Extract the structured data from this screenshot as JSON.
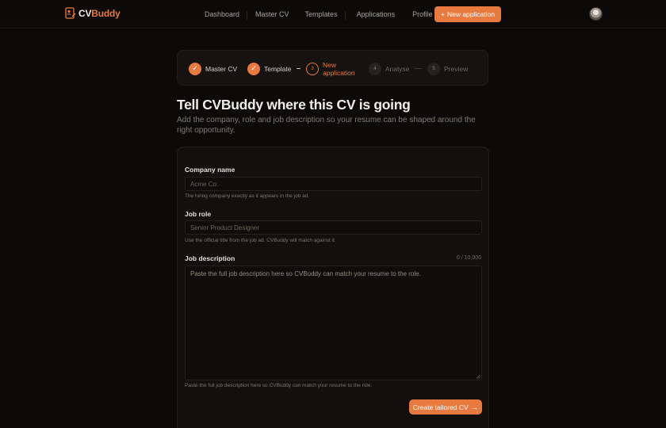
{
  "brand": {
    "name_part1": "CV",
    "name_part2": "Buddy",
    "accent_color": "#e97a3f"
  },
  "nav": {
    "links": [
      "Dashboard",
      "Master CV",
      "Templates",
      "Applications",
      "Profile"
    ],
    "cta_icon": "+",
    "cta_label": "New application"
  },
  "stepper": {
    "steps": [
      {
        "marker": "✓",
        "label": "Master CV",
        "state": "done"
      },
      {
        "marker": "✓",
        "label": "Template",
        "state": "done"
      },
      {
        "marker": "3",
        "label": "New application",
        "state": "current"
      },
      {
        "marker": "4",
        "label": "Analyse",
        "state": "pending"
      },
      {
        "marker": "5",
        "label": "Preview",
        "state": "pending"
      }
    ]
  },
  "page": {
    "title": "Tell CVBuddy where this CV is going",
    "subtitle": "Add the company, role and job description so your resume can be shaped around the right opportunity."
  },
  "form": {
    "company": {
      "label": "Company name",
      "placeholder": "Acme Co.",
      "help": "The hiring company exactly as it appears in the job ad."
    },
    "role": {
      "label": "Job role",
      "placeholder": "Senior Product Designer",
      "help": "Use the official title from the job ad. CVBuddy will match against it."
    },
    "description": {
      "label": "Job description",
      "counter": "0 / 10,000",
      "placeholder": "Paste the full job description here so CVBuddy can match your resume to the role.",
      "help": "Paste the full job description here so CVBuddy can match your resume to the role."
    },
    "submit_label": "Create tailored CV",
    "submit_icon": "→"
  }
}
